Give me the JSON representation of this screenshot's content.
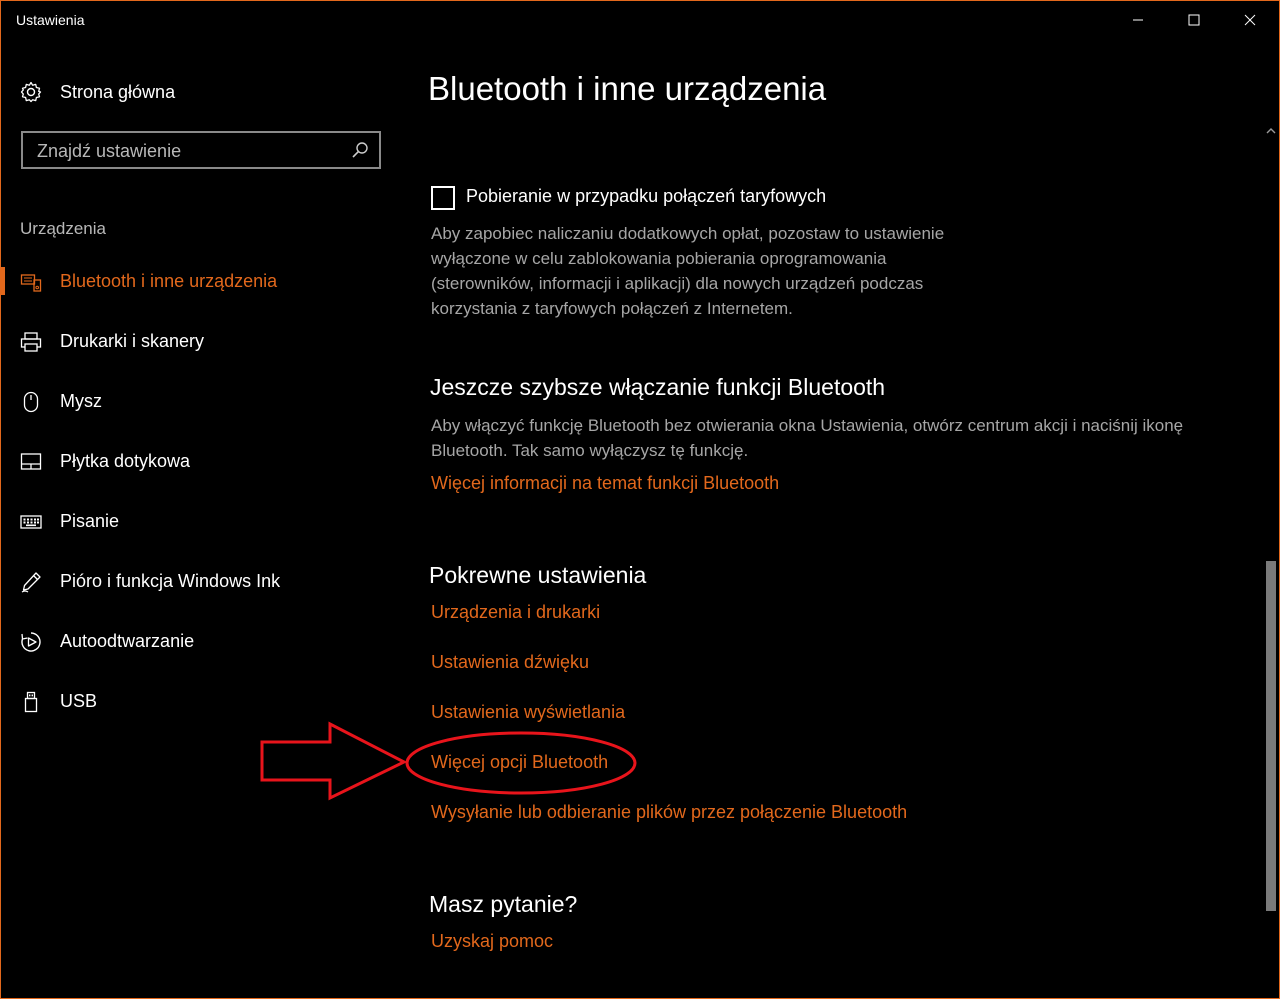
{
  "window": {
    "title": "Ustawienia",
    "accent_color": "#e2681c",
    "controls": [
      "minimize-icon",
      "maximize-icon",
      "close-icon"
    ]
  },
  "sidebar": {
    "home_label": "Strona główna",
    "home_icon": "gear-icon",
    "search_placeholder": "Znajdź ustawienie",
    "search_icon": "search-icon",
    "section_label": "Urządzenia",
    "items": [
      {
        "label": "Bluetooth i inne urządzenia",
        "icon": "bluetooth-devices-icon",
        "active": true
      },
      {
        "label": "Drukarki i skanery",
        "icon": "printer-icon"
      },
      {
        "label": "Mysz",
        "icon": "mouse-icon"
      },
      {
        "label": "Płytka dotykowa",
        "icon": "touchpad-icon"
      },
      {
        "label": "Pisanie",
        "icon": "keyboard-icon"
      },
      {
        "label": "Pióro i funkcja Windows Ink",
        "icon": "pen-icon"
      },
      {
        "label": "Autoodtwarzanie",
        "icon": "autoplay-icon"
      },
      {
        "label": "USB",
        "icon": "usb-icon"
      }
    ]
  },
  "main": {
    "title": "Bluetooth i inne urządzenia",
    "metered": {
      "checkbox_label": "Pobieranie w przypadku połączeń taryfowych",
      "checked": false,
      "description": "Aby zapobiec naliczaniu dodatkowych opłat, pozostaw to ustawienie wyłączone w celu zablokowania pobierania oprogramowania (sterowników, informacji i aplikacji) dla nowych urządzeń podczas korzystania z taryfowych połączeń z Internetem."
    },
    "faster": {
      "heading": "Jeszcze szybsze włączanie funkcji Bluetooth",
      "description": "Aby włączyć funkcję Bluetooth bez otwierania okna Ustawienia, otwórz centrum akcji i naciśnij ikonę Bluetooth. Tak samo wyłączysz tę funkcję.",
      "link": "Więcej informacji na temat funkcji Bluetooth"
    },
    "related": {
      "heading": "Pokrewne ustawienia",
      "links": [
        "Urządzenia i drukarki",
        "Ustawienia dźwięku",
        "Ustawienia wyświetlania",
        "Więcej opcji Bluetooth",
        "Wysyłanie lub odbieranie plików przez połączenie Bluetooth"
      ]
    },
    "question": {
      "heading": "Masz pytanie?",
      "link": "Uzyskaj pomoc"
    }
  },
  "annotation": {
    "color": "#e8141b",
    "highlighted_link": "Więcej opcji Bluetooth"
  }
}
